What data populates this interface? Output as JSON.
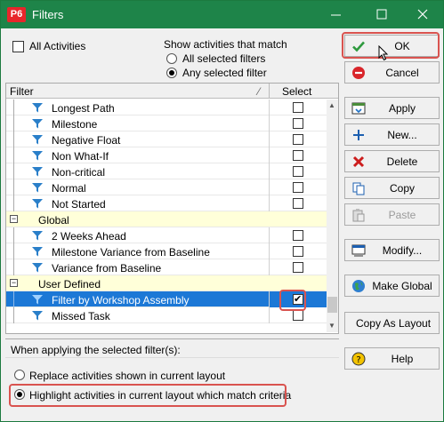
{
  "window": {
    "title": "Filters",
    "app_icon_text": "P6"
  },
  "top": {
    "all_activities_label": "All Activities",
    "match_heading": "Show activities that match",
    "match_options": [
      {
        "label": "All selected filters",
        "selected": false
      },
      {
        "label": "Any selected filter",
        "selected": true
      }
    ]
  },
  "grid": {
    "columns": {
      "filter": "Filter",
      "select": "Select"
    },
    "rows": [
      {
        "type": "filter",
        "label": "Longest Path",
        "checked": false
      },
      {
        "type": "filter",
        "label": "Milestone",
        "checked": false
      },
      {
        "type": "filter",
        "label": "Negative Float",
        "checked": false
      },
      {
        "type": "filter",
        "label": "Non What-If",
        "checked": false
      },
      {
        "type": "filter",
        "label": "Non-critical",
        "checked": false
      },
      {
        "type": "filter",
        "label": "Normal",
        "checked": false
      },
      {
        "type": "filter",
        "label": "Not Started",
        "checked": false
      },
      {
        "type": "group",
        "label": "Global"
      },
      {
        "type": "filter",
        "label": "2 Weeks Ahead",
        "checked": false
      },
      {
        "type": "filter",
        "label": "Milestone Variance from Baseline",
        "checked": false
      },
      {
        "type": "filter",
        "label": "Variance from Baseline",
        "checked": false
      },
      {
        "type": "group",
        "label": "User Defined"
      },
      {
        "type": "filter",
        "label": "Filter by Workshop Assembly",
        "checked": true,
        "selected": true
      },
      {
        "type": "filter",
        "label": "Missed Task",
        "checked": false
      }
    ]
  },
  "bottom": {
    "heading": "When applying the selected filter(s):",
    "options": [
      {
        "label": "Replace activities shown in current layout",
        "selected": false
      },
      {
        "label": "Highlight activities in current layout which match criteria",
        "selected": true
      }
    ]
  },
  "buttons": {
    "ok": "OK",
    "cancel": "Cancel",
    "apply": "Apply",
    "new": "New...",
    "delete": "Delete",
    "copy": "Copy",
    "paste": "Paste",
    "modify": "Modify...",
    "make_global": "Make Global",
    "copy_as_layout": "Copy As Layout",
    "help": "Help"
  },
  "colors": {
    "titlebar": "#1e8449",
    "selection": "#1c78d6",
    "group_row": "#ffffd9",
    "annotation_red": "#d9534f",
    "filter_icon": "#2a7fc9"
  }
}
